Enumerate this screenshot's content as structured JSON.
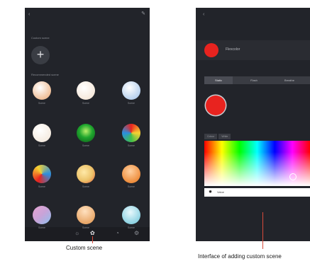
{
  "left_screen": {
    "section_top_label": "Custom scene",
    "section_preset_label": "Recommended scene",
    "add_button_label": "+",
    "scenes": [
      {
        "label": "Scene",
        "color": "#f0c09a",
        "style": "radial"
      },
      {
        "label": "Scene",
        "color": "#f6e9dc",
        "style": "radial"
      },
      {
        "label": "Scene",
        "color": "#b9d2ef",
        "style": "radial"
      },
      {
        "label": "Scene",
        "color": "#f5ece2",
        "style": "radial"
      },
      {
        "label": "Scene",
        "color": "#1fa62e",
        "style": "green"
      },
      {
        "label": "Scene",
        "color": "#e84a3b",
        "style": "rainbow"
      },
      {
        "label": "Scene",
        "color": "#2a8fe0",
        "style": "rainbow2"
      },
      {
        "label": "Scene",
        "color": "#ecc36a",
        "style": "warm"
      },
      {
        "label": "Scene",
        "color": "#ee8e3e",
        "style": "orange"
      },
      {
        "label": "Scene",
        "color": "#c8a3d8",
        "style": "mix"
      },
      {
        "label": "Scene",
        "color": "#e9a86a",
        "style": "peach"
      },
      {
        "label": "Scene",
        "color": "#8fd3e3",
        "style": "cyan"
      }
    ]
  },
  "right_screen": {
    "scene_name": "Flexcolor",
    "tabs": [
      "Static",
      "Flash",
      "Breathe"
    ],
    "subtabs": [
      "Colour",
      "White"
    ],
    "selected_color": "#e8231f",
    "value_label": "Value"
  },
  "captions": {
    "left": "Custom scene",
    "right": "Interface of adding custom scene"
  },
  "colors": {
    "screen_bg": "#22242a",
    "accent_red": "#e8231f",
    "pointer_line": "#d84a3a"
  }
}
